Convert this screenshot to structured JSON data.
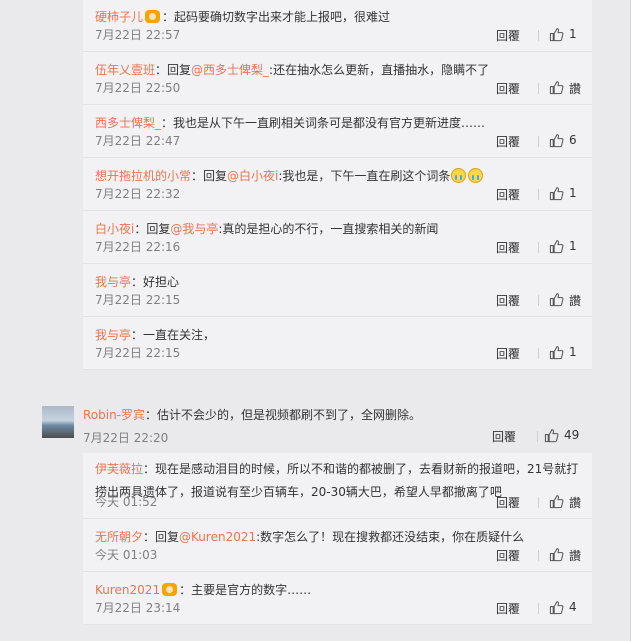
{
  "reply_label": "回覆",
  "top_replies": [
    {
      "user": "硬柿子儿",
      "badge": true,
      "text": "：起码要确切数字出来才能上报吧，很难过",
      "time": "7月22日 22:57",
      "likes": "1"
    },
    {
      "user": "伍年乂壹班",
      "prefix": "：回复",
      "at": "@西多士俾梨_",
      "text": ":还在抽水怎么更新，直播抽水，隐瞒不了",
      "time": "7月22日 22:50",
      "likes": "讚"
    },
    {
      "user": "西多士俾梨_",
      "text": "：我也是从下午一直刷相关词条可是都没有官方更新进度……",
      "time": "7月22日 22:47",
      "likes": "6"
    },
    {
      "user": "想开拖拉机的小常",
      "prefix": "：回复",
      "at": "@白小夜i",
      "text": ":我也是，下午一直在刷这个词条",
      "emoji": 2,
      "time": "7月22日 22:32",
      "likes": "1"
    },
    {
      "user": "白小夜i",
      "prefix": "：回复",
      "at": "@我与亭",
      "text": ":真的是担心的不行，一直搜索相关的新闻",
      "time": "7月22日 22:16",
      "likes": "1"
    },
    {
      "user": "我与亭",
      "text": "：好担心",
      "time": "7月22日 22:15",
      "likes": "讚"
    },
    {
      "user": "我与亭",
      "text": "：一直在关注，",
      "time": "7月22日 22:15",
      "likes": "1"
    }
  ],
  "main_comment": {
    "user": "Robin-罗宾",
    "text": "：估计不会少的，但是视频都刷不到了，全网删除。",
    "time": "7月22日 22:20",
    "likes": "49"
  },
  "bottom_replies": [
    {
      "user": "伊芙薇拉",
      "text": "：现在是感动泪目的时候，所以不和谐的都被删了，去看财新的报道吧，21号就打捞出两具遗体了，报道说有至少百辆车，20-30辆大巴，希望人早都撤离了吧",
      "time": "今天 01:52",
      "likes": "讚"
    },
    {
      "user": "无所朝夕",
      "prefix": "：回复",
      "at": "@Kuren2021",
      "text": ":数字怎么了！现在搜救都还没结束，你在质疑什么",
      "time": "今天 01:03",
      "likes": "讚"
    },
    {
      "user": "Kuren2021",
      "badge": true,
      "text": "：主要是官方的数字……",
      "time": "7月22日 23:14",
      "likes": "4"
    }
  ]
}
